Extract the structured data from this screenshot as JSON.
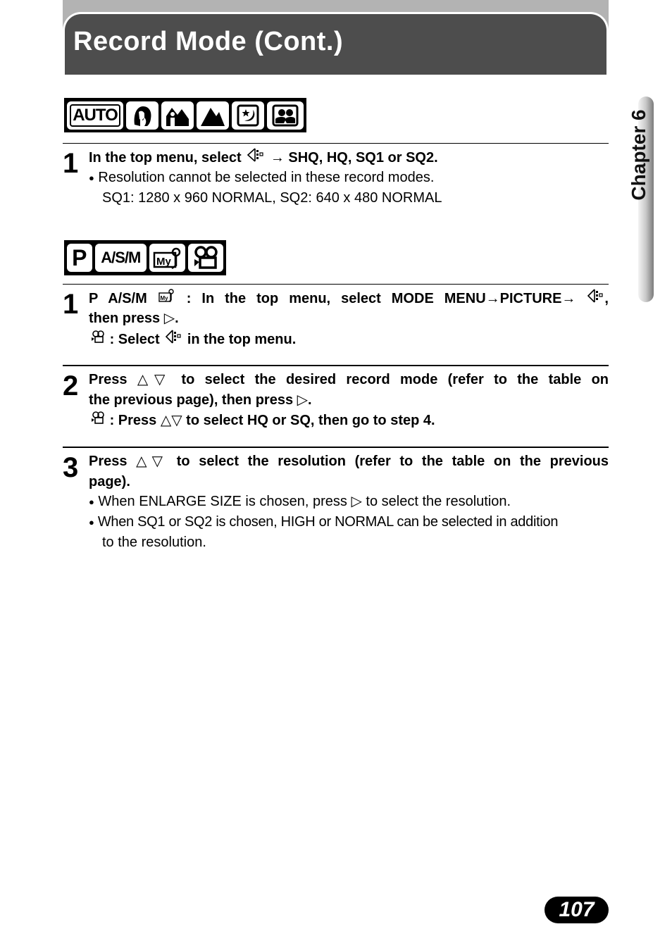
{
  "header": {
    "title": "Record Mode (Cont.)"
  },
  "chapter_tab": {
    "label": "Chapter 6"
  },
  "page_number": "107",
  "section1": {
    "mode_icons": [
      "AUTO",
      "portrait-icon",
      "landscape-portrait-icon",
      "landscape-icon",
      "night-scene-icon",
      "self-portrait-icon"
    ],
    "auto_label": "AUTO",
    "step1": {
      "number": "1",
      "line1_a": "In the top menu, select",
      "line1_b": "→ SHQ, HQ, SQ1 or SQ2.",
      "bullet1": "Resolution cannot be selected in these record modes.",
      "bullet1_cont": "SQ1: 1280 x 960 NORMAL, SQ2: 640 x 480 NORMAL"
    }
  },
  "section2": {
    "mode_icons": [
      "P",
      "A/S/M",
      "my-mode-icon",
      "movie-icon"
    ],
    "p_label": "P",
    "asm_label": "A/S/M",
    "my_label": "My",
    "step1": {
      "number": "1",
      "line1_a": "P A/S/M",
      "line1_b": ": In the top menu, select MODE MENU→PICTURE→",
      "line1_c": ",",
      "line2": "then press",
      "line2_end": ".",
      "line3_a": ": Select",
      "line3_b": "in the top menu."
    },
    "step2": {
      "number": "2",
      "line1_a": "Press",
      "line1_b": "to select the desired record mode (refer to the table on",
      "line2": "the previous page), then press",
      "line2_end": ".",
      "line3_a": ": Press",
      "line3_b": "to select HQ or SQ, then go to step 4."
    },
    "step3": {
      "number": "3",
      "line1_a": "Press",
      "line1_b": "to select the resolution (refer to the table on the previous",
      "line2": "page).",
      "bullet1_a": "When ENLARGE SIZE is chosen, press",
      "bullet1_b": "to select the resolution.",
      "bullet2": "When SQ1 or SQ2 is chosen, HIGH or NORMAL can be selected in addition",
      "bullet2_cont": "to the resolution."
    }
  },
  "symbols": {
    "arrow_right": "▷",
    "up_down": "△▽",
    "bullet": "●"
  }
}
